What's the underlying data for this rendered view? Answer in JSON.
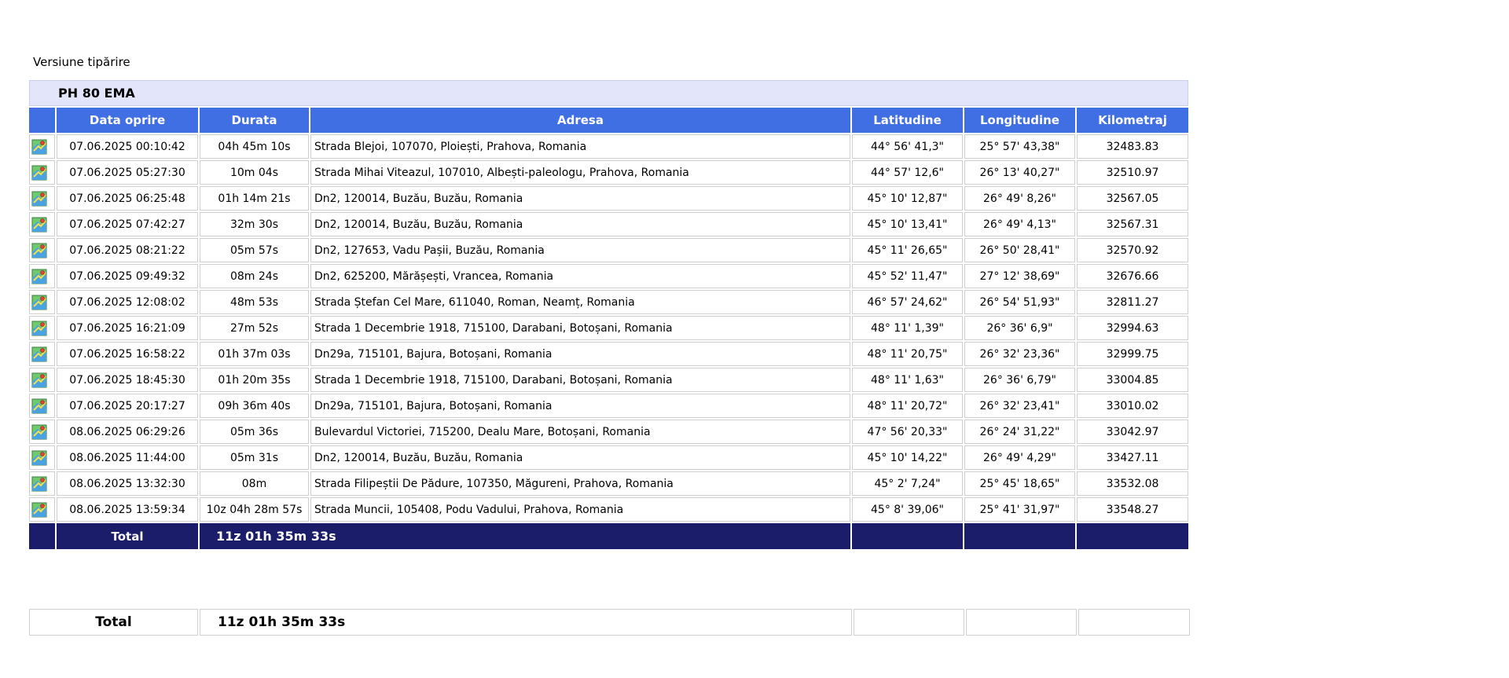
{
  "print_link": "Versiune tipărire",
  "vehicle": "PH 80 EMA",
  "columns": [
    "Data oprire",
    "Durata",
    "Adresa",
    "Latitudine",
    "Longitudine",
    "Kilometraj"
  ],
  "icon": "map-icon",
  "colors": {
    "header_bg": "#3f6fe3",
    "title_bg": "#e3e6fa",
    "total_bg": "#1b1d6b"
  },
  "rows": [
    {
      "date": "07.06.2025 00:10:42",
      "duration": "04h 45m 10s",
      "address": "Strada Blejoi,  107070, Ploiești, Prahova, Romania",
      "lat": "44° 56' 41,3\"",
      "lon": "25° 57' 43,38\"",
      "km": "32483.83"
    },
    {
      "date": "07.06.2025 05:27:30",
      "duration": "10m 04s",
      "address": "Strada Mihai Viteazul,  107010, Albești-paleologu, Prahova, Romania",
      "lat": "44° 57' 12,6\"",
      "lon": "26° 13' 40,27\"",
      "km": "32510.97"
    },
    {
      "date": "07.06.2025 06:25:48",
      "duration": "01h 14m 21s",
      "address": "Dn2,  120014, Buzău, Buzău, Romania",
      "lat": "45° 10' 12,87\"",
      "lon": "26° 49' 8,26\"",
      "km": "32567.05"
    },
    {
      "date": "07.06.2025 07:42:27",
      "duration": "32m 30s",
      "address": "Dn2,  120014, Buzău, Buzău, Romania",
      "lat": "45° 10' 13,41\"",
      "lon": "26° 49' 4,13\"",
      "km": "32567.31"
    },
    {
      "date": "07.06.2025 08:21:22",
      "duration": "05m 57s",
      "address": "Dn2,  127653, Vadu Pașii, Buzău, Romania",
      "lat": "45° 11' 26,65\"",
      "lon": "26° 50' 28,41\"",
      "km": "32570.92"
    },
    {
      "date": "07.06.2025 09:49:32",
      "duration": "08m 24s",
      "address": "Dn2,  625200, Mărășești, Vrancea, Romania",
      "lat": "45° 52' 11,47\"",
      "lon": "27° 12' 38,69\"",
      "km": "32676.66"
    },
    {
      "date": "07.06.2025 12:08:02",
      "duration": "48m 53s",
      "address": "Strada Ștefan Cel Mare,  611040, Roman, Neamț, Romania",
      "lat": "46° 57' 24,62\"",
      "lon": "26° 54' 51,93\"",
      "km": "32811.27"
    },
    {
      "date": "07.06.2025 16:21:09",
      "duration": "27m 52s",
      "address": "Strada 1 Decembrie 1918,  715100, Darabani, Botoșani, Romania",
      "lat": "48° 11' 1,39\"",
      "lon": "26° 36' 6,9\"",
      "km": "32994.63"
    },
    {
      "date": "07.06.2025 16:58:22",
      "duration": "01h 37m 03s",
      "address": "Dn29a,  715101, Bajura, Botoșani, Romania",
      "lat": "48° 11' 20,75\"",
      "lon": "26° 32' 23,36\"",
      "km": "32999.75"
    },
    {
      "date": "07.06.2025 18:45:30",
      "duration": "01h 20m 35s",
      "address": "Strada 1 Decembrie 1918,  715100, Darabani, Botoșani, Romania",
      "lat": "48° 11' 1,63\"",
      "lon": "26° 36' 6,79\"",
      "km": "33004.85"
    },
    {
      "date": "07.06.2025 20:17:27",
      "duration": "09h 36m 40s",
      "address": "Dn29a,  715101, Bajura, Botoșani, Romania",
      "lat": "48° 11' 20,72\"",
      "lon": "26° 32' 23,41\"",
      "km": "33010.02"
    },
    {
      "date": "08.06.2025 06:29:26",
      "duration": "05m 36s",
      "address": "Bulevardul Victoriei,  715200, Dealu Mare, Botoșani, Romania",
      "lat": "47° 56' 20,33\"",
      "lon": "26° 24' 31,22\"",
      "km": "33042.97"
    },
    {
      "date": "08.06.2025 11:44:00",
      "duration": "05m 31s",
      "address": "Dn2,  120014, Buzău, Buzău, Romania",
      "lat": "45° 10' 14,22\"",
      "lon": "26° 49' 4,29\"",
      "km": "33427.11"
    },
    {
      "date": "08.06.2025 13:32:30",
      "duration": "08m",
      "address": "Strada Filipeștii De Pădure,  107350, Măgureni, Prahova, Romania",
      "lat": "45° 2' 7,24\"",
      "lon": "25° 45' 18,65\"",
      "km": "33532.08"
    },
    {
      "date": "08.06.2025 13:59:34",
      "duration": "10z 04h 28m 57s",
      "address": "Strada Muncii,  105408, Podu Vadului, Prahova, Romania",
      "lat": "45° 8' 39,06\"",
      "lon": "25° 41' 31,97\"",
      "km": "33548.27"
    }
  ],
  "total": {
    "label": "Total",
    "duration": "11z 01h 35m 33s"
  },
  "summary": {
    "label": "Total",
    "duration": "11z 01h 35m 33s"
  }
}
